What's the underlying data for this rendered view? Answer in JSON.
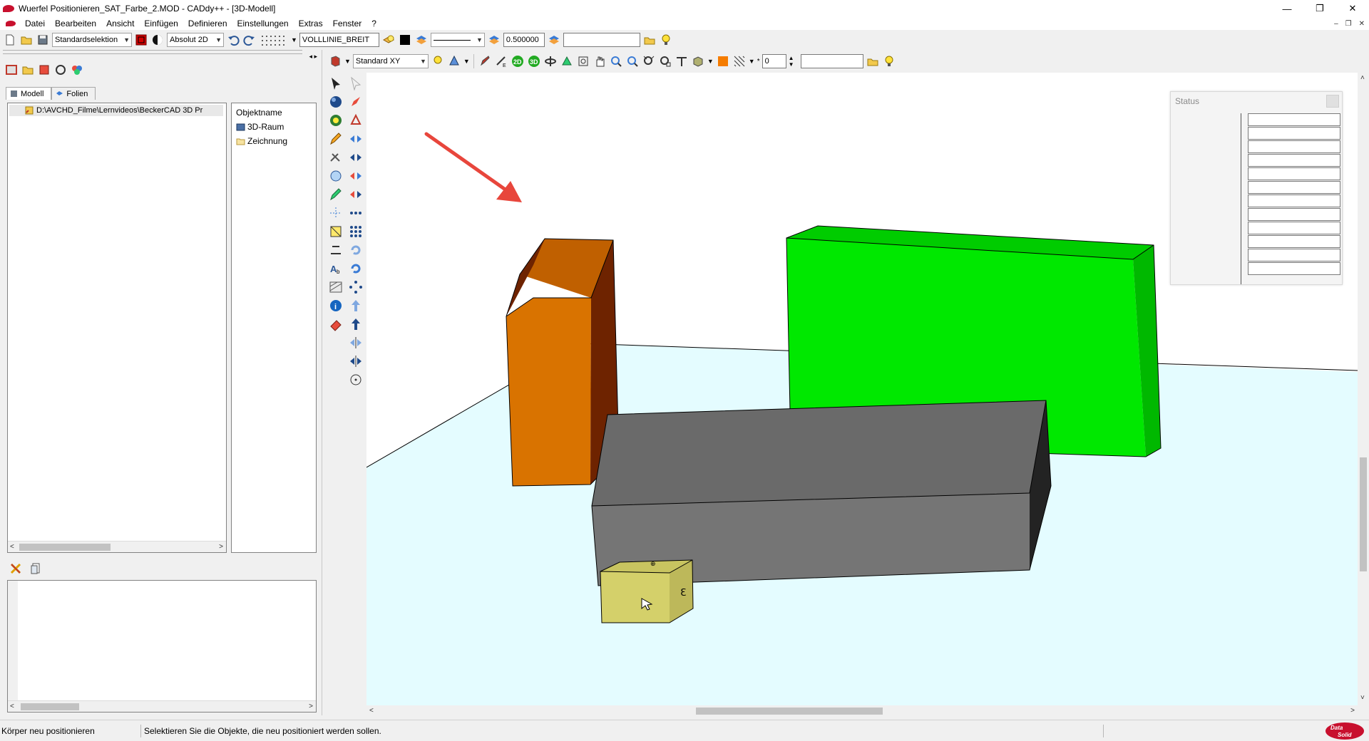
{
  "window": {
    "title": "Wuerfel Positionieren_SAT_Farbe_2.MOD  -  CADdy++ - [3D-Modell]",
    "minimize": "—",
    "restore": "❐",
    "close": "✕"
  },
  "menu": {
    "items": [
      "Datei",
      "Bearbeiten",
      "Ansicht",
      "Einfügen",
      "Definieren",
      "Einstellungen",
      "Extras",
      "Fenster",
      "?"
    ],
    "mdi_minimize": "–",
    "mdi_restore": "❐",
    "mdi_close": "✕"
  },
  "toolbar1": {
    "selection_mode": "Standardselektion",
    "coord_mode": "Absolut 2D",
    "line_type": "VOLLLINIE_BREIT",
    "line_width": "0.500000",
    "extra_field": ""
  },
  "toolbar2": {
    "view": "Standard XY",
    "layer_value": "0",
    "extra_field": ""
  },
  "left_panel": {
    "tabs": [
      "Modell",
      "Folien"
    ],
    "active_tab": "Modell",
    "tree_path": "D:\\AVCHD_Filme\\Lernvideos\\BeckerCAD 3D Pr",
    "object_header": "Objektname",
    "objects": [
      "3D-Raum",
      "Zeichnung"
    ]
  },
  "status_window": {
    "title": "Status",
    "rows": 12
  },
  "statusbar": {
    "command": "Körper neu positionieren",
    "message": "Selektieren Sie die Objekte, die neu positioniert werden sollen.",
    "logo_text": "Data Solid"
  },
  "colors": {
    "orange_front": "#d97300",
    "orange_side": "#6e2300",
    "orange_top": "#c06000",
    "green_front": "#00e800",
    "green_top": "#00cc00",
    "green_side": "#00b800",
    "gray_front": "#757575",
    "gray_top": "#6a6a6a",
    "gray_side": "#232323",
    "yellow_front": "#d4d06a",
    "yellow_top": "#c8c460",
    "yellow_side": "#bdb85a",
    "floor": "#e4fcff",
    "arrow": "#e8463c"
  }
}
